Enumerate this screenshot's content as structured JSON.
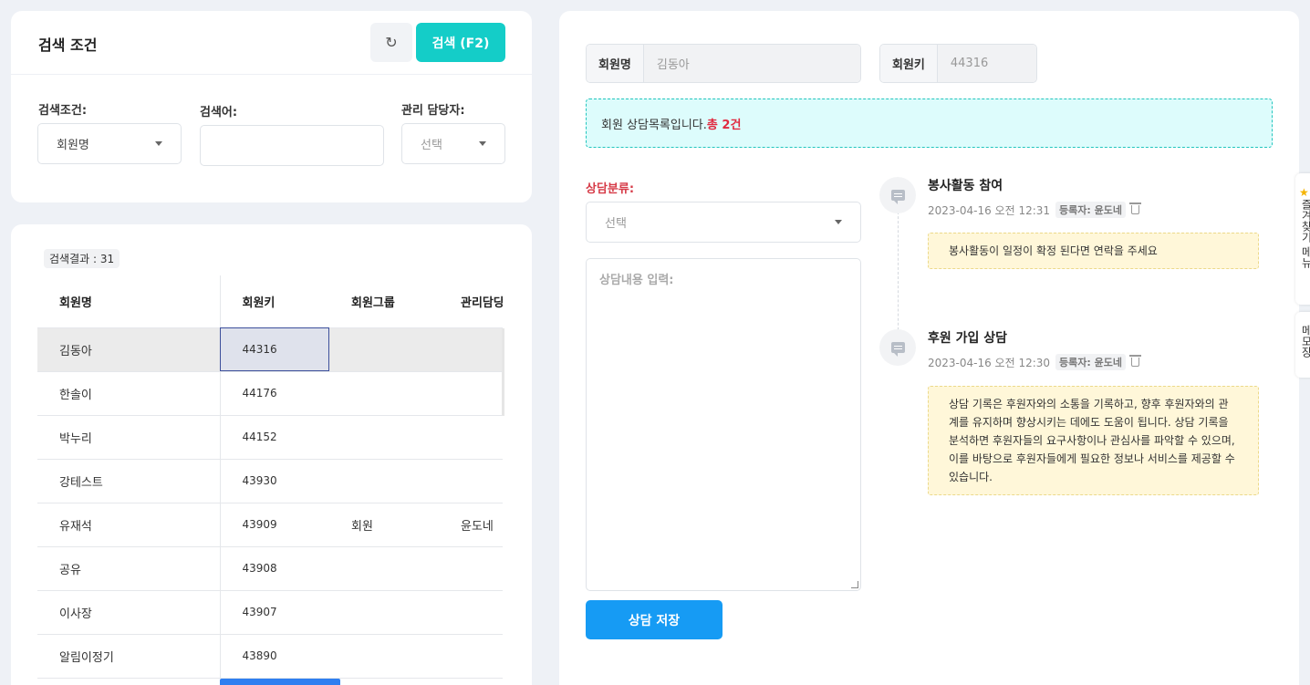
{
  "search": {
    "title": "검색 조건",
    "refresh_icon": "↻",
    "search_button": "검색 (F2)",
    "condition_label": "검색조건:",
    "condition_value": "회원명",
    "keyword_label": "검색어:",
    "keyword_value": "",
    "manager_label": "관리 담당자:",
    "manager_value": "선택"
  },
  "results": {
    "count_label": "검색결과 : 31",
    "columns": [
      "회원명",
      "회원키",
      "회원그룹",
      "관리담당자"
    ],
    "rows": [
      {
        "name": "김동아",
        "key": "44316",
        "group": "",
        "manager": ""
      },
      {
        "name": "한솔이",
        "key": "44176",
        "group": "",
        "manager": ""
      },
      {
        "name": "박누리",
        "key": "44152",
        "group": "",
        "manager": ""
      },
      {
        "name": "강테스트",
        "key": "43930",
        "group": "",
        "manager": ""
      },
      {
        "name": "유재석",
        "key": "43909",
        "group": "회원",
        "manager": "윤도네"
      },
      {
        "name": "공유",
        "key": "43908",
        "group": "",
        "manager": ""
      },
      {
        "name": "이사장",
        "key": "43907",
        "group": "",
        "manager": ""
      },
      {
        "name": "알림이정기",
        "key": "43890",
        "group": "",
        "manager": ""
      }
    ]
  },
  "detail": {
    "member_name_label": "회원명",
    "member_name_value": "김동아",
    "member_key_label": "회원키",
    "member_key_value": "44316",
    "notice_text": "회원 상담목록입니다.",
    "notice_count": "총 2건",
    "category_label": "상담분류:",
    "category_value": "선택",
    "content_placeholder": "상담내용 입력:",
    "save_button": "상담 저장"
  },
  "timeline": [
    {
      "title": "봉사활동 참여",
      "date": "2023-04-16 오전 12:31",
      "registrar": "등록자: 윤도네",
      "body": "봉사활동이 일정이 확정 된다면 연락을 주세요"
    },
    {
      "title": "후원 가입 상담",
      "date": "2023-04-16 오전 12:30",
      "registrar": "등록자: 윤도네",
      "body": "상담 기록은 후원자와의 소통을 기록하고, 향후 후원자와의 관계를 유지하며 향상시키는 데에도 도움이 됩니다. 상담 기록을 분석하면 후원자들의 요구사항이나 관심사를 파악할 수 있으며, 이를 바탕으로 후원자들에게 필요한 정보나 서비스를 제공할 수 있습니다."
    }
  ],
  "side_tabs": [
    "즐겨찾기 메뉴",
    "메모장"
  ],
  "colors": {
    "accent_teal": "#14cdc8",
    "save_blue": "#169bf4",
    "count_red": "#e0293f"
  }
}
